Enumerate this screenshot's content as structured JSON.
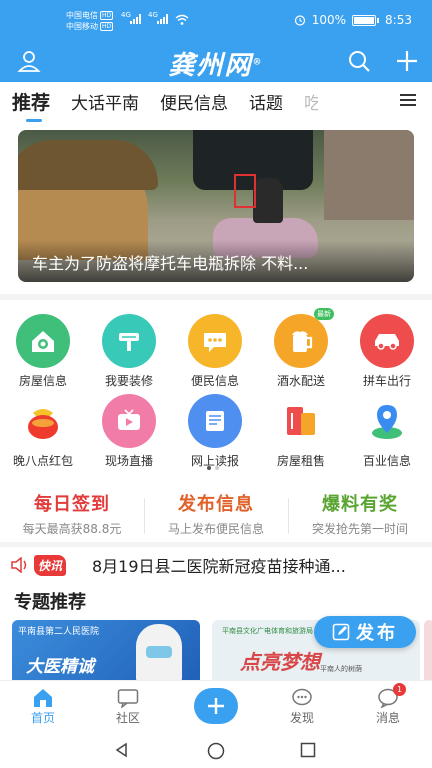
{
  "status_bar": {
    "carrier1": "中国电信",
    "carrier2": "中国移动",
    "hd": "HD",
    "net1": "4G",
    "net2": "4G",
    "battery": "100%",
    "time": "8:53"
  },
  "header": {
    "logo": "龚州网",
    "logo_mark": "®"
  },
  "tabs": [
    "推荐",
    "大话平南",
    "便民信息",
    "话题",
    "吃"
  ],
  "banner": {
    "caption": "车主为了防盗将摩托车电瓶拆除 不料..."
  },
  "grid": [
    {
      "label": "房屋信息",
      "color": "#3fbf7a",
      "icon": "house-icon"
    },
    {
      "label": "我要装修",
      "color": "#38c9b8",
      "icon": "brush-icon"
    },
    {
      "label": "便民信息",
      "color": "#f7b529",
      "icon": "chat-icon"
    },
    {
      "label": "酒水配送",
      "color": "#f5a629",
      "icon": "beer-icon",
      "badge": "最新"
    },
    {
      "label": "拼车出行",
      "color": "#ef4d4d",
      "icon": "car-icon"
    },
    {
      "label": "晚八点红包",
      "color": "#f28b24",
      "icon": "money-bag-icon"
    },
    {
      "label": "现场直播",
      "color": "#f27ca8",
      "icon": "tv-icon"
    },
    {
      "label": "网上读报",
      "color": "#4f8ff0",
      "icon": "newspaper-icon"
    },
    {
      "label": "房屋租售",
      "color": "#ef4d4d",
      "icon": "building-icon"
    },
    {
      "label": "百业信息",
      "color": "#3b8cf0",
      "icon": "map-pin-icon"
    }
  ],
  "features": [
    {
      "title": "每日签到",
      "subtitle": "每天最高获88.8元",
      "color": "#e23b3b"
    },
    {
      "title": "发布信息",
      "subtitle": "马上发布便民信息",
      "color": "#e0622b"
    },
    {
      "title": "爆料有奖",
      "subtitle": "突发抢先第一时间",
      "color": "#5aa531"
    }
  ],
  "ticker": {
    "tag": "快讯",
    "text": "8月19日县二医院新冠疫苗接种通..."
  },
  "section": {
    "title": "专题推荐"
  },
  "cards": {
    "card1_org": "平南县第二人民医院",
    "card1_title": "大医精诚",
    "card2_org": "平南县文化广电体育和旅游局",
    "card2_title": "点亮梦想",
    "card2_sub": "平南人的树荫"
  },
  "publish_button": "发布",
  "bottom_nav": [
    {
      "label": "首页",
      "icon": "home-icon"
    },
    {
      "label": "社区",
      "icon": "community-icon"
    },
    {
      "label": "发现",
      "icon": "discover-icon"
    },
    {
      "label": "消息",
      "icon": "message-icon",
      "badge": "1"
    }
  ]
}
